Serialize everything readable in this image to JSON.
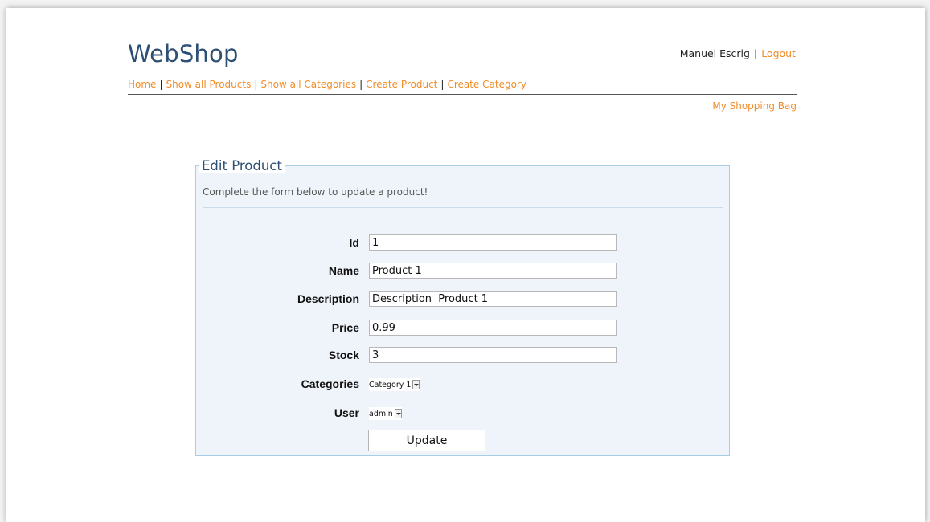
{
  "header": {
    "logo": "WebShop",
    "user_name": "Manuel Escrig",
    "separator": "|",
    "logout": "Logout"
  },
  "nav": {
    "items": [
      "Home",
      "Show all Products",
      "Show all Categories",
      "Create Product",
      "Create Category"
    ],
    "separator": "|"
  },
  "shopping_bag": "My Shopping Bag",
  "form": {
    "legend": "Edit Product",
    "intro": "Complete the form below to update a product!",
    "fields": {
      "id": {
        "label": "Id",
        "value": "1"
      },
      "name": {
        "label": "Name",
        "value": "Product 1"
      },
      "description": {
        "label": "Description",
        "value": "Description  Product 1"
      },
      "price": {
        "label": "Price",
        "value": "0.99"
      },
      "stock": {
        "label": "Stock",
        "value": "3"
      },
      "categories": {
        "label": "Categories",
        "selected": "Category 1"
      },
      "user": {
        "label": "User",
        "selected": "admin"
      }
    },
    "submit": "Update"
  },
  "colors": {
    "accent_link": "#f28c28",
    "logo": "#2d4f73",
    "panel_bg": "#eef4fa",
    "panel_border": "#a8cde6"
  }
}
